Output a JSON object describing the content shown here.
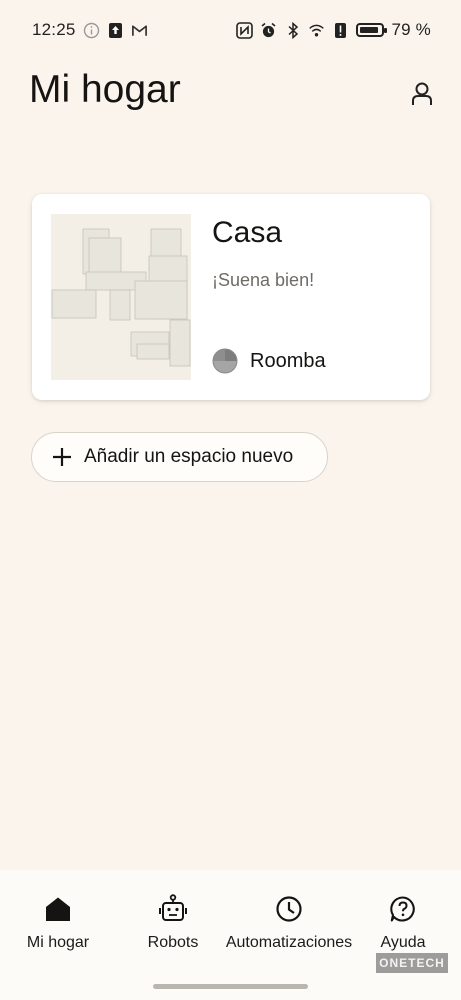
{
  "status_bar": {
    "time": "12:25",
    "battery_percent": "79 %",
    "battery_level": 0.79,
    "icons_left": [
      "info-icon",
      "upload-box-icon",
      "gmail-icon"
    ],
    "icons_right": [
      "nfc-icon",
      "alarm-icon",
      "bluetooth-icon",
      "wifi-icon",
      "alert-icon",
      "battery-icon"
    ]
  },
  "header": {
    "title": "Mi hogar"
  },
  "home_card": {
    "name": "Casa",
    "status": "¡Suena bien!",
    "robot_name": "Roomba"
  },
  "add_space": {
    "label": "Añadir un espacio nuevo"
  },
  "bottom_nav": {
    "items": [
      {
        "label": "Mi hogar",
        "icon": "home-icon",
        "active": true
      },
      {
        "label": "Robots",
        "icon": "robot-icon",
        "active": false
      },
      {
        "label": "Automatizaciones",
        "icon": "clock-icon",
        "active": false
      },
      {
        "label": "Ayuda",
        "icon": "help-icon",
        "active": false
      }
    ]
  },
  "watermark": "ONETECH",
  "colors": {
    "background": "#faf4ec",
    "card": "#ffffff",
    "text": "#151412",
    "muted_text": "#6f6b66",
    "map_room": "#e8e5dd"
  }
}
